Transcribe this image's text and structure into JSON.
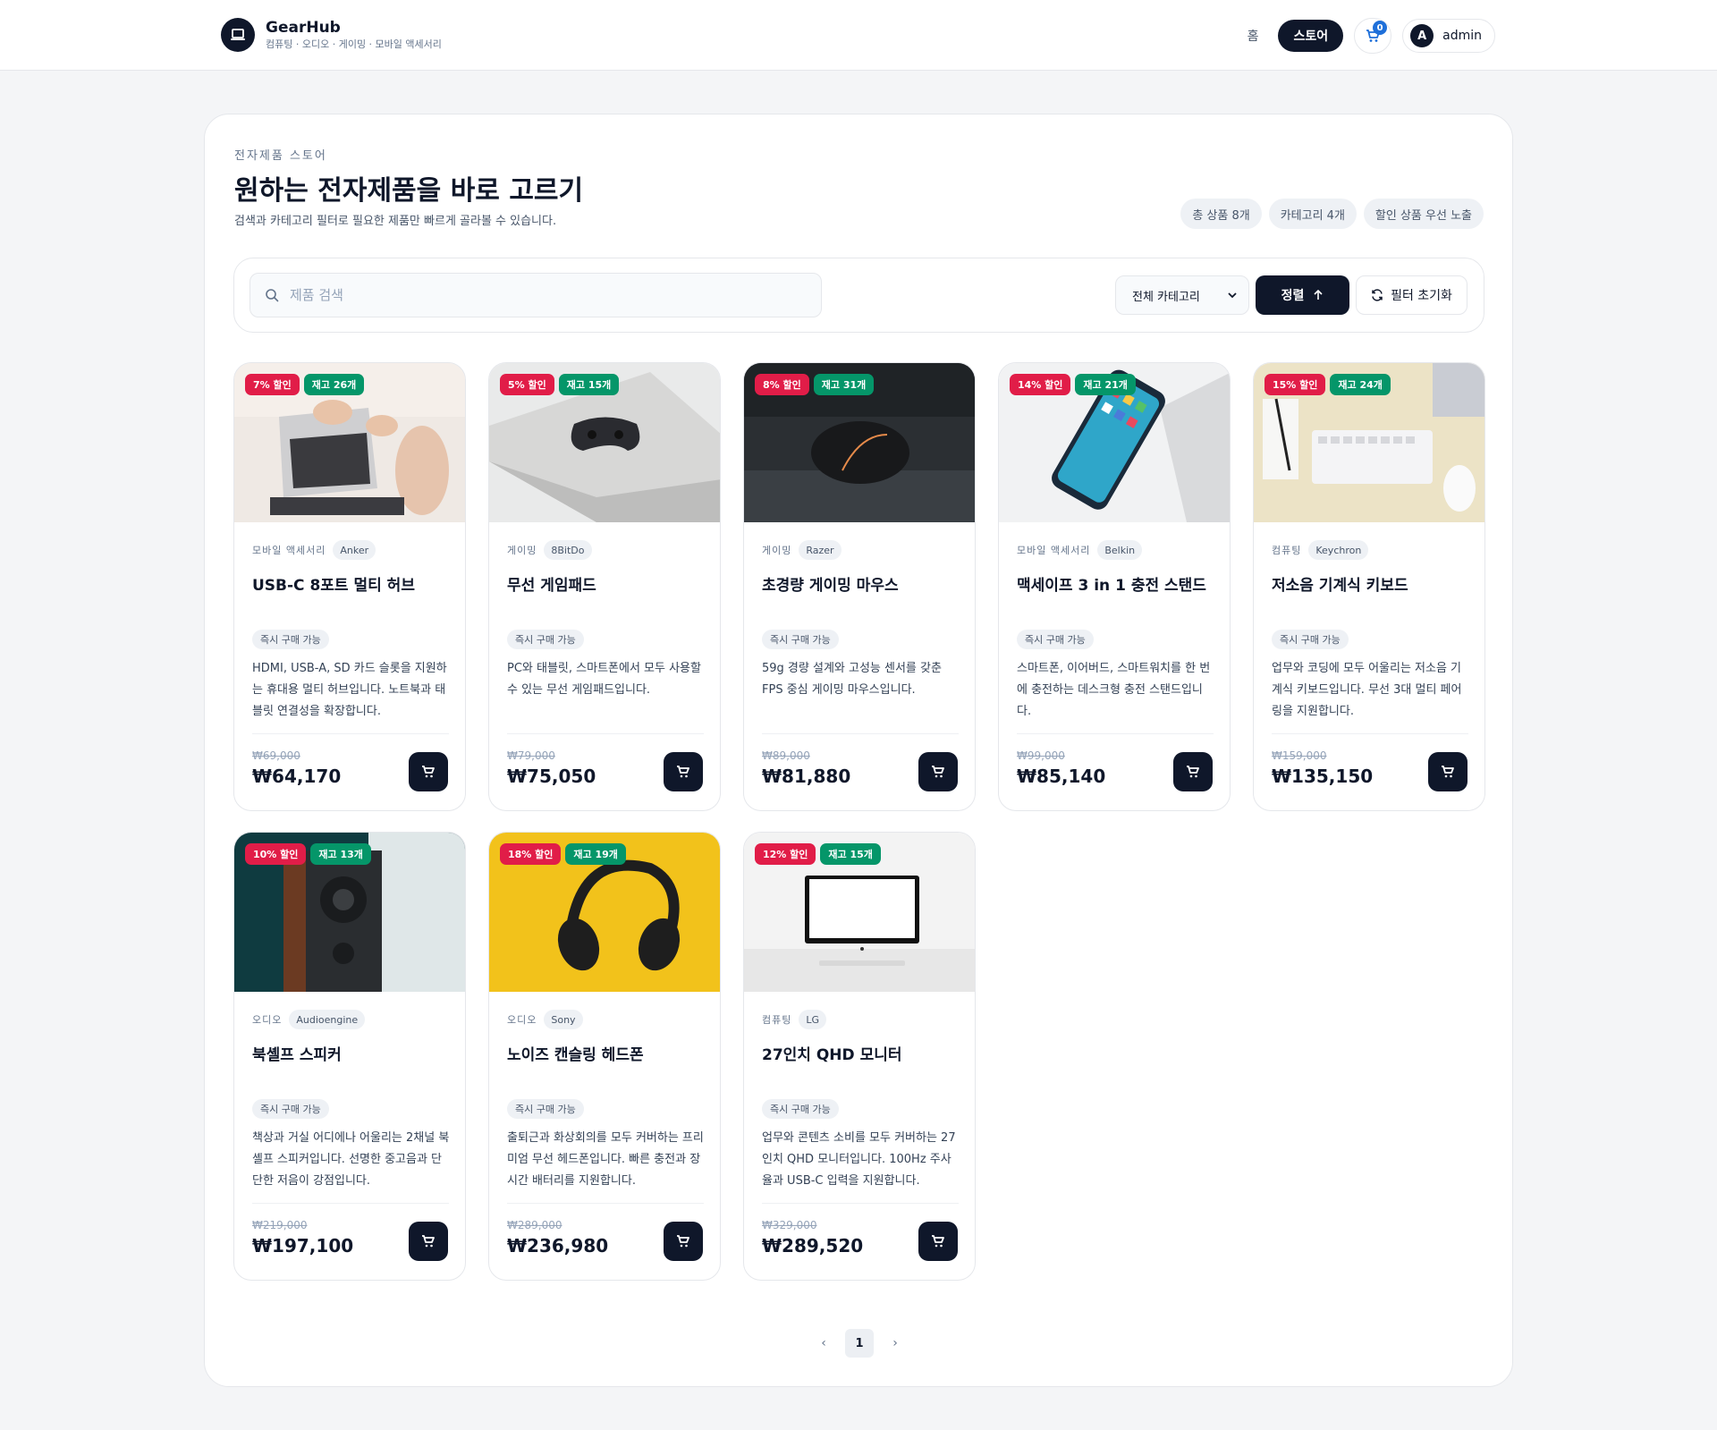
{
  "app": {
    "name": "GearHub",
    "tagline": "컴퓨팅 · 오디오 · 게이밍 · 모바일 액세서리"
  },
  "nav": {
    "home": "홈",
    "store": "스토어",
    "cart_count": "0",
    "user_initial": "A",
    "user_name": "admin"
  },
  "hero": {
    "eyebrow": "전자제품 스토어",
    "title": "원하는 전자제품을 바로 고르기",
    "subtitle": "검색과 카테고리 필터로 필요한 제품만 빠르게 골라볼 수 있습니다.",
    "chips": [
      "총 상품 8개",
      "카테고리 4개",
      "할인 상품 우선 노출"
    ]
  },
  "filters": {
    "search_placeholder": "제품 검색",
    "category_selected": "전체 카테고리",
    "sort_label": "정렬",
    "reset_label": "필터 초기화"
  },
  "products": [
    {
      "discount": "7% 할인",
      "stock": "재고 26개",
      "category": "모바일 액세서리",
      "brand": "Anker",
      "name": "USB-C 8포트 멀티 허브",
      "status": "즉시 구매 가능",
      "desc": "HDMI, USB-A, SD 카드 슬롯을 지원하는 휴대용 멀티 허브입니다. 노트북과 태블릿 연결성을 확장합니다.",
      "old_price": "₩69,000",
      "price": "₩64,170"
    },
    {
      "discount": "5% 할인",
      "stock": "재고 15개",
      "category": "게이밍",
      "brand": "8BitDo",
      "name": "무선 게임패드",
      "status": "즉시 구매 가능",
      "desc": "PC와 태블릿, 스마트폰에서 모두 사용할 수 있는 무선 게임패드입니다.",
      "old_price": "₩79,000",
      "price": "₩75,050"
    },
    {
      "discount": "8% 할인",
      "stock": "재고 31개",
      "category": "게이밍",
      "brand": "Razer",
      "name": "초경량 게이밍 마우스",
      "status": "즉시 구매 가능",
      "desc": "59g 경량 설계와 고성능 센서를 갖춘 FPS 중심 게이밍 마우스입니다.",
      "old_price": "₩89,000",
      "price": "₩81,880"
    },
    {
      "discount": "14% 할인",
      "stock": "재고 21개",
      "category": "모바일 액세서리",
      "brand": "Belkin",
      "name": "맥세이프 3 in 1 충전 스탠드",
      "status": "즉시 구매 가능",
      "desc": "스마트폰, 이어버드, 스마트워치를 한 번에 충전하는 데스크형 충전 스탠드입니다.",
      "old_price": "₩99,000",
      "price": "₩85,140"
    },
    {
      "discount": "15% 할인",
      "stock": "재고 24개",
      "category": "컴퓨팅",
      "brand": "Keychron",
      "name": "저소음 기계식 키보드",
      "status": "즉시 구매 가능",
      "desc": "업무와 코딩에 모두 어울리는 저소음 기계식 키보드입니다. 무선 3대 멀티 페어링을 지원합니다.",
      "old_price": "₩159,000",
      "price": "₩135,150"
    },
    {
      "discount": "10% 할인",
      "stock": "재고 13개",
      "category": "오디오",
      "brand": "Audioengine",
      "name": "북셸프 스피커",
      "status": "즉시 구매 가능",
      "desc": "책상과 거실 어디에나 어울리는 2채널 북셸프 스피커입니다. 선명한 중고음과 단단한 저음이 강점입니다.",
      "old_price": "₩219,000",
      "price": "₩197,100"
    },
    {
      "discount": "18% 할인",
      "stock": "재고 19개",
      "category": "오디오",
      "brand": "Sony",
      "name": "노이즈 캔슬링 헤드폰",
      "status": "즉시 구매 가능",
      "desc": "출퇴근과 화상회의를 모두 커버하는 프리미엄 무선 헤드폰입니다. 빠른 충전과 장시간 배터리를 지원합니다.",
      "old_price": "₩289,000",
      "price": "₩236,980"
    },
    {
      "discount": "12% 할인",
      "stock": "재고 15개",
      "category": "컴퓨팅",
      "brand": "LG",
      "name": "27인치 QHD 모니터",
      "status": "즉시 구매 가능",
      "desc": "업무와 콘텐츠 소비를 모두 커버하는 27인치 QHD 모니터입니다. 100Hz 주사율과 USB-C 입력을 지원합니다.",
      "old_price": "₩329,000",
      "price": "₩289,520"
    }
  ],
  "pagination": {
    "current": "1"
  },
  "colors": {
    "primary": "#0f172a",
    "sale": "#e11d48",
    "stock": "#059669",
    "badge_blue": "#1e6fd9"
  },
  "icons": [
    "laptop-icon",
    "cart-icon",
    "search-icon",
    "chevron-down-icon",
    "arrow-up-icon",
    "refresh-icon",
    "chevron-left-icon",
    "chevron-right-icon"
  ]
}
